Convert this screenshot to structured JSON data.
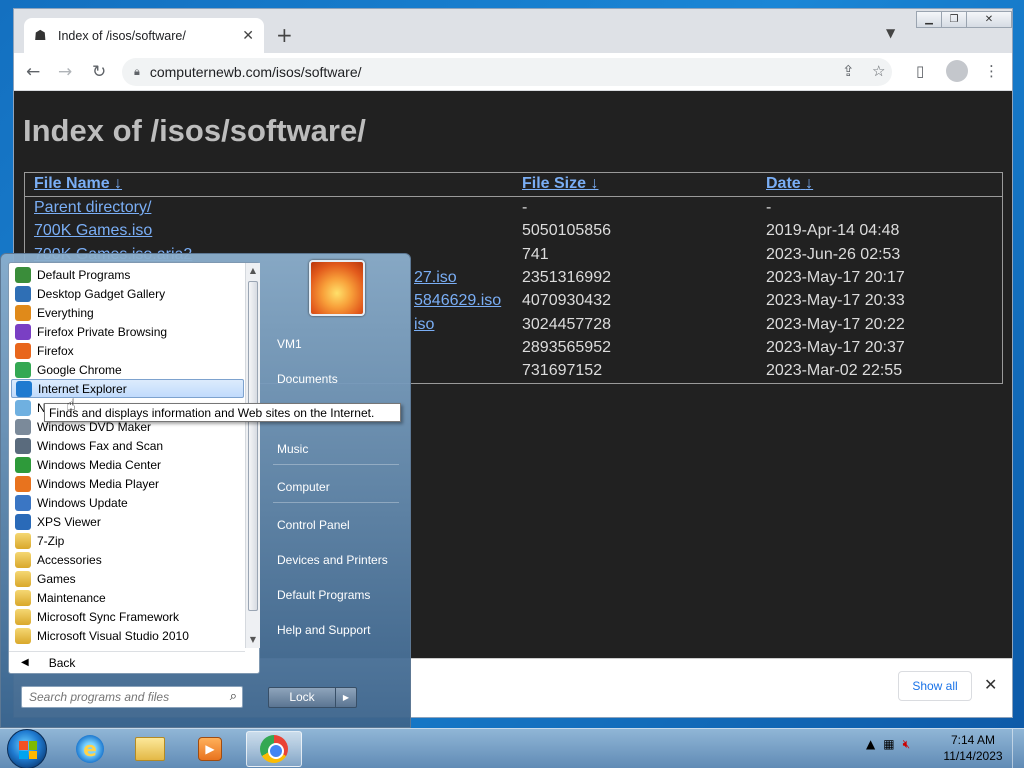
{
  "browser": {
    "tab_title": "Index of /isos/software/",
    "tab_close": "✕",
    "new_tab": "+",
    "url": "computernewb.com/isos/software/",
    "show_all": "Show all",
    "download_close": "✕"
  },
  "page": {
    "heading": "Index of /isos/software/",
    "headers": {
      "name": "File Name",
      "size": "File Size",
      "date": "Date",
      "sort_arrow": "↓"
    },
    "rows": [
      {
        "name": "Parent directory/",
        "size": "-",
        "date": "-"
      },
      {
        "name": "700K Games.iso",
        "size": "5050105856",
        "date": "2019-Apr-14 04:48"
      },
      {
        "name": "700K Games.iso.aria2",
        "size": "741",
        "date": "2023-Jun-26 02:53"
      },
      {
        "name": "27.iso",
        "size": "2351316992",
        "date": "2023-May-17 20:17"
      },
      {
        "name": "5846629.iso",
        "size": "4070930432",
        "date": "2023-May-17 20:33"
      },
      {
        "name": "iso",
        "size": "3024457728",
        "date": "2023-May-17 20:22"
      },
      {
        "name": "",
        "size": "2893565952",
        "date": "2023-May-17 20:37"
      },
      {
        "name": "",
        "size": "731697152",
        "date": "2023-Mar-02 22:55"
      }
    ]
  },
  "startmenu": {
    "programs": [
      {
        "label": "Default Programs",
        "icon": "default-programs-icon",
        "color": "#3a8d3a"
      },
      {
        "label": "Desktop Gadget Gallery",
        "icon": "gadget-gallery-icon",
        "color": "#2f6fb5"
      },
      {
        "label": "Everything",
        "icon": "everything-icon",
        "color": "#e08a1a"
      },
      {
        "label": "Firefox Private Browsing",
        "icon": "firefox-private-icon",
        "color": "#7a3fc4"
      },
      {
        "label": "Firefox",
        "icon": "firefox-icon",
        "color": "#e8661c"
      },
      {
        "label": "Google Chrome",
        "icon": "chrome-icon",
        "color": "#34a853"
      },
      {
        "label": "Internet Explorer",
        "icon": "internet-explorer-icon",
        "color": "#1f7ad0"
      },
      {
        "label": "Notepad",
        "icon": "notepad-icon",
        "color": "#6fb0e0"
      },
      {
        "label": "Windows DVD Maker",
        "icon": "dvd-maker-icon",
        "color": "#7b8a9a"
      },
      {
        "label": "Windows Fax and Scan",
        "icon": "fax-scan-icon",
        "color": "#5a6b7d"
      },
      {
        "label": "Windows Media Center",
        "icon": "media-center-icon",
        "color": "#2e9a3a"
      },
      {
        "label": "Windows Media Player",
        "icon": "media-player-icon",
        "color": "#e8731e"
      },
      {
        "label": "Windows Update",
        "icon": "windows-update-icon",
        "color": "#3a76c4"
      },
      {
        "label": "XPS Viewer",
        "icon": "xps-viewer-icon",
        "color": "#2a6ab8"
      },
      {
        "label": "7-Zip",
        "icon": "folder-icon",
        "color": "folder"
      },
      {
        "label": "Accessories",
        "icon": "folder-icon",
        "color": "folder"
      },
      {
        "label": "Games",
        "icon": "folder-icon",
        "color": "folder"
      },
      {
        "label": "Maintenance",
        "icon": "folder-icon",
        "color": "folder"
      },
      {
        "label": "Microsoft Sync Framework",
        "icon": "folder-icon",
        "color": "folder"
      },
      {
        "label": "Microsoft Visual Studio 2010",
        "icon": "folder-icon",
        "color": "folder"
      }
    ],
    "back": "Back",
    "search_placeholder": "Search programs and files",
    "right_items": [
      "VM1",
      "Documents",
      "Pictures",
      "Music",
      "Computer",
      "Control Panel",
      "Devices and Printers",
      "Default Programs",
      "Help and Support"
    ],
    "lock": "Lock",
    "tooltip": "Finds and displays information and Web sites on the Internet."
  },
  "taskbar": {
    "time": "7:14 AM",
    "date": "11/14/2023"
  }
}
